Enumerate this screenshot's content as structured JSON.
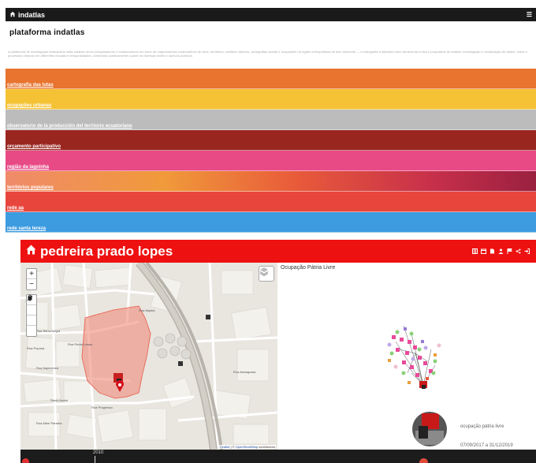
{
  "top_screenshot": {
    "header": {
      "home_icon": "home-icon",
      "brand": "indatlas",
      "menu_icon": "hamburger-icon"
    },
    "title": "plataforma indatlas",
    "intro_text": "a plataforma de investigação indisciplinar atlas indatlas reúne pesquisadores e colaboradores em torno de mapeamentos colaborativos de lutas, territórios, conflitos urbanos, cartografias sociais e ocupações na região metropolitana de belo horizonte — a cartografia é utilizada como ferramenta crítica e propositiva de análise, investigação e visualização de dados, redes e processos urbanos em diferentes escalas e temporalidades, construída coletivamente a partir de diversas fontes e acervos públicos.",
    "bands": [
      {
        "label": "cartografia das lutas",
        "color": "#e8742f"
      },
      {
        "label": "ocupações urbanas",
        "color": "#f4c234"
      },
      {
        "label": "observatorio de la producción del territorio ecuatoriano",
        "color": "#bcbcbc"
      },
      {
        "label": "orçamento participativo",
        "color": "#9a2620"
      },
      {
        "label": "região da lagoinha",
        "color": "#e84a86"
      },
      {
        "label": "territórios populares",
        "color": "gradient"
      },
      {
        "label": "rede aa",
        "color": "#e8453c"
      },
      {
        "label": "rede santa tereza",
        "color": "#3d9be0"
      }
    ]
  },
  "app": {
    "title": "pedreira prado lopes",
    "title_icon": "home-icon",
    "toolbar_icons": [
      "map-icon",
      "calendar-icon",
      "document-icon",
      "person-icon",
      "flag-icon",
      "share-icon",
      "login-icon"
    ],
    "map": {
      "zoom_in": "+",
      "zoom_out": "−",
      "draw_tools": [
        "draw-line-icon",
        "draw-circle-icon",
        "draw-square-icon",
        "draw-marker-icon"
      ],
      "layers_icon": "layers-icon",
      "street_labels": [
        "Rua Serra Negra",
        "Rua Popuna",
        "Rua Pedro Lessa",
        "Rua Itapecerica",
        "Rua Progresso",
        "Rua Além Paraíba",
        "Rua Itajubá",
        "Rua Araraquara",
        "Santo André"
      ],
      "attribution_leaflet": "Leaflet",
      "attribution_sep": " | © ",
      "attribution_osm": "OpenStreetMap",
      "attribution_tail": " contributors"
    },
    "network_panel": {
      "title": "Ocupação Pátria Livre",
      "place_name": "ocupação pátria livre",
      "date_range": "07/09/2017 a 31/12/2019"
    },
    "timeline": {
      "year_label": "2010"
    },
    "colors": {
      "accent": "#ee1111",
      "timeline_bg": "#1c1c1c"
    }
  }
}
